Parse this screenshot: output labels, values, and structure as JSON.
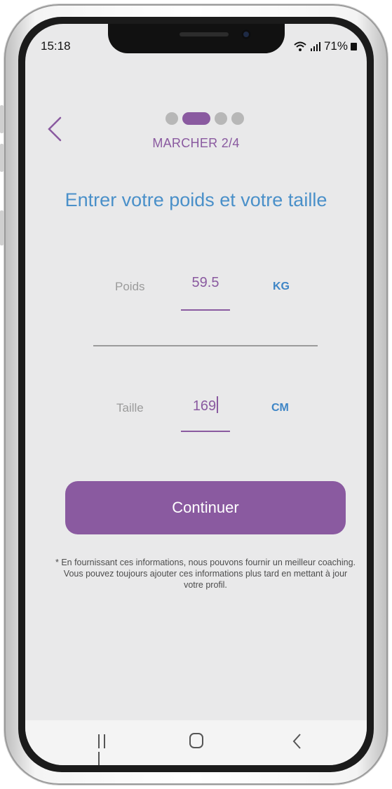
{
  "status_bar": {
    "time": "15:18",
    "battery": "71%"
  },
  "header": {
    "back_icon": "chevron-left-icon",
    "progress": {
      "total_steps": 4,
      "current_step": 2
    },
    "step_label": "MARCHER 2/4"
  },
  "page": {
    "title": "Entrer votre poids et votre taille"
  },
  "form": {
    "weight": {
      "label": "Poids",
      "value": "59.5",
      "unit": "KG"
    },
    "height": {
      "label": "Taille",
      "value": "169",
      "unit": "CM"
    }
  },
  "actions": {
    "continue_label": "Continuer"
  },
  "note": "* En fournissant ces informations, nous pouvons fournir un meilleur coaching. Vous pouvez toujours ajouter ces informations plus tard en mettant à jour votre profil.",
  "colors": {
    "accent": "#8a5aa0",
    "title_blue": "#4a90c9",
    "unit_blue": "#3f86c6",
    "background": "#e9e9ea"
  },
  "nav_bar": {
    "icons": [
      "recent-apps-icon",
      "home-icon",
      "back-icon"
    ]
  }
}
